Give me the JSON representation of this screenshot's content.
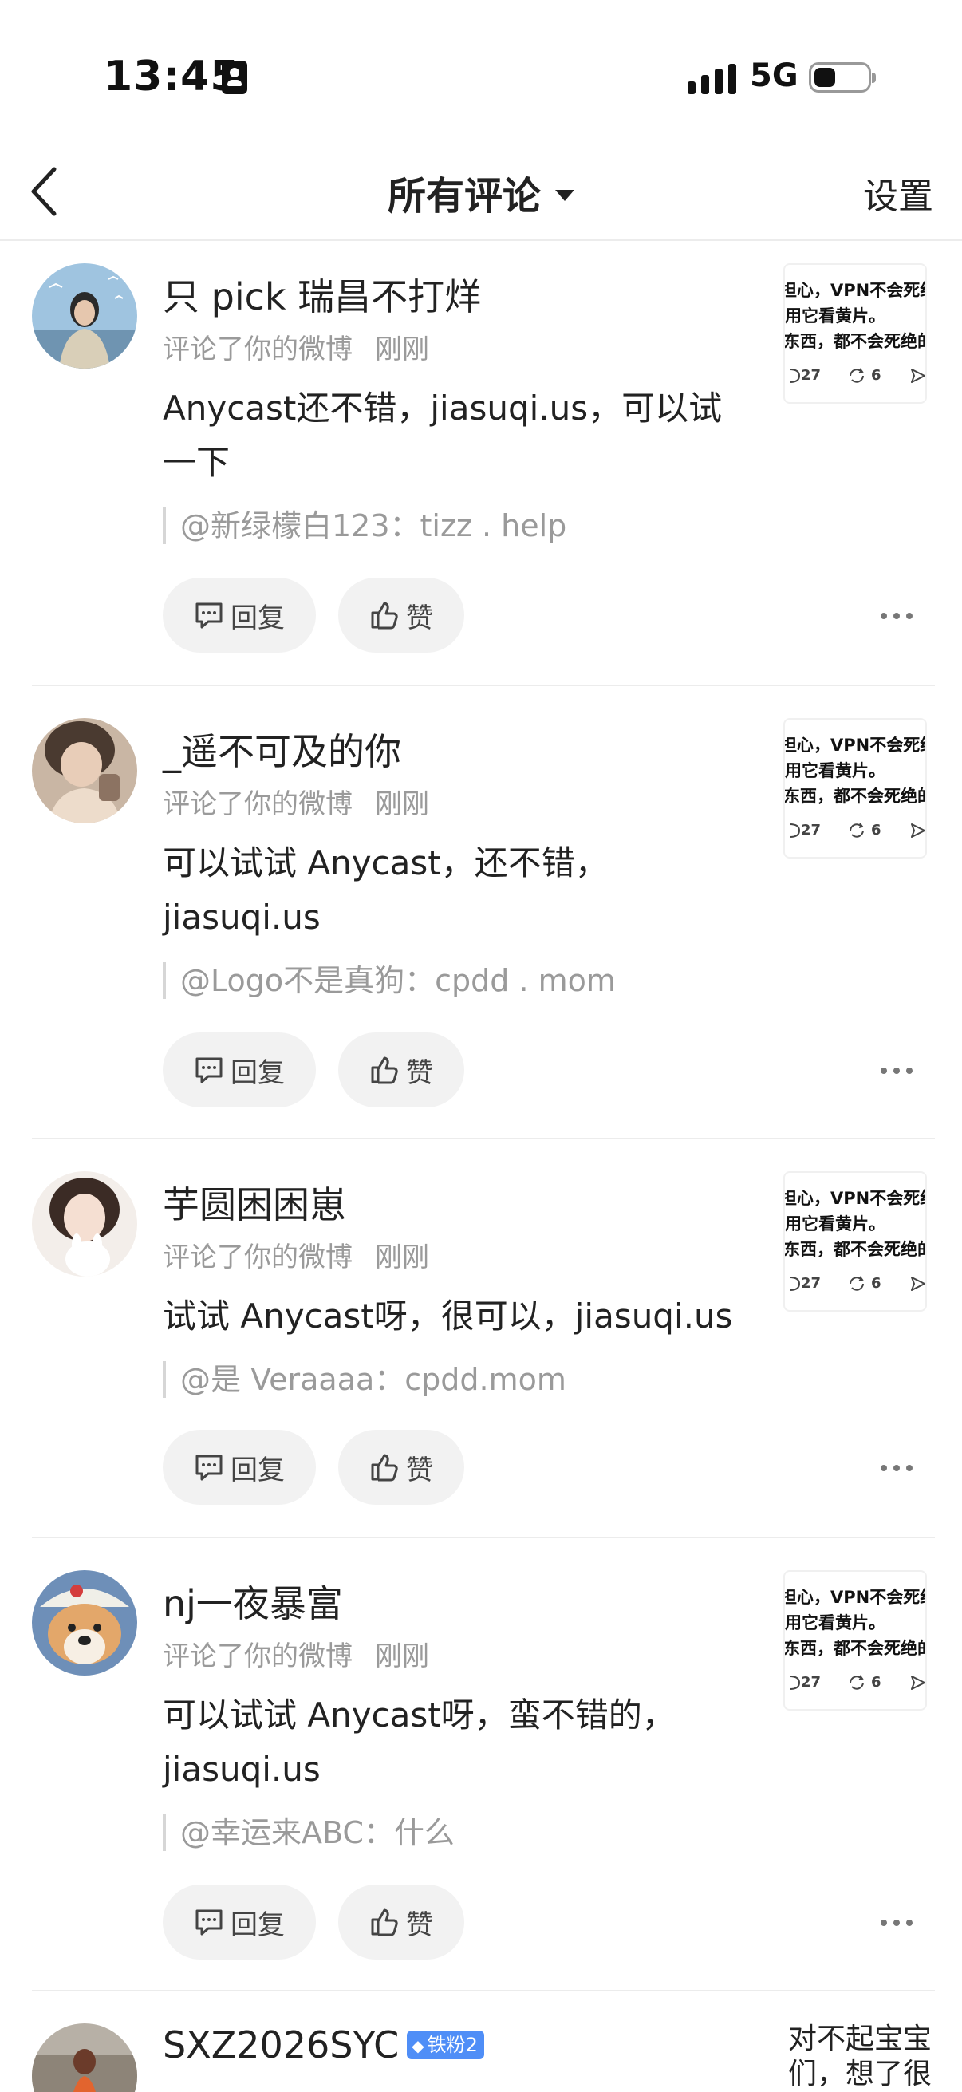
{
  "status_bar": {
    "time": "13:45",
    "network": "5G",
    "battery_level": 0.4
  },
  "nav": {
    "title": "所有评论",
    "settings_label": "设置"
  },
  "actions": {
    "reply_label": "回复",
    "like_label": "赞"
  },
  "thumbnail": {
    "line1": "担心，VPN不会死绝",
    "line2": "用它看黄片。",
    "line3": "东西，都不会死绝的",
    "comments": "27",
    "reposts": "6"
  },
  "comments": [
    {
      "username": "只 pick 瑞昌不打烊",
      "action": "评论了你的微博",
      "time": "刚刚",
      "content": "Anycast还不错，jiasuqi.us，可以试一下",
      "quote": "@新绿檬白123：tizz . help"
    },
    {
      "username": "_遥不可及的你",
      "action": "评论了你的微博",
      "time": "刚刚",
      "content": "可以试试 Anycast，还不错，jiasuqi.us",
      "quote": "@Logo不是真狗：cpdd . mom"
    },
    {
      "username": "芋圆困困崽",
      "action": "评论了你的微博",
      "time": "刚刚",
      "content": "试试 Anycast呀，很可以，jiasuqi.us",
      "quote": "@是 Veraaaa：cpdd.mom"
    },
    {
      "username": "nj一夜暴富",
      "action": "评论了你的微博",
      "time": "刚刚",
      "content": "可以试试 Anycast呀，蛮不错的，jiasuqi.us",
      "quote": "@幸运来ABC：什么"
    },
    {
      "username": "SXZ2026SYC",
      "badge": "铁粉2",
      "preview": "对不起宝宝们，想了很"
    }
  ]
}
